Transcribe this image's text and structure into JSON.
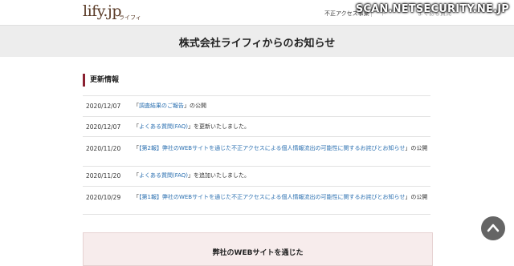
{
  "header": {
    "logo": "lify.jp",
    "logo_sub": "ライフィ",
    "nav": [
      "不正アクセス事案",
      "ト",
      "よくある質問"
    ],
    "watermark": "SCAN.NETSECURITY.NE.JP"
  },
  "page_title": "株式会社ライフィからのお知らせ",
  "section_title": "更新情報",
  "rows": [
    {
      "date": "2020/12/07",
      "pre": "「",
      "link": "調査結果のご報告",
      "post": "」の公開"
    },
    {
      "date": "2020/12/07",
      "pre": "「",
      "link": "よくある質問(FAQ)",
      "post": "」を更新いたしました。"
    },
    {
      "date": "2020/11/20",
      "pre": "「",
      "link": "【第2報】弊社のWEBサイトを通じた不正アクセスによる個人情報流出の可能性に関するお詫びとお知らせ",
      "post": "」の公開"
    },
    {
      "date": "2020/11/20",
      "pre": "「",
      "link": "よくある質問(FAQ)",
      "post": "」を追加いたしました。"
    },
    {
      "date": "2020/10/29",
      "pre": "「",
      "link": "【第1報】弊社のWEBサイトを通じた不正アクセスによる個人情報流出の可能性に関するお詫びとお知らせ",
      "post": "」の公開"
    }
  ],
  "notice_box": {
    "title": "弊社のWEBサイトを通じた"
  },
  "icons": {
    "scroll_top": "chevron-up-icon"
  }
}
